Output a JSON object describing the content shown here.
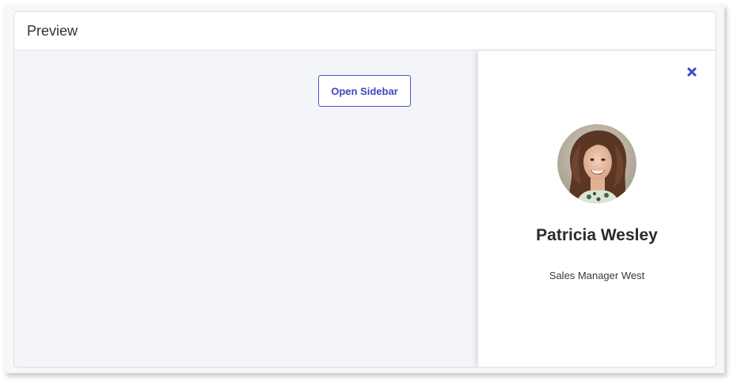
{
  "panel": {
    "title": "Preview"
  },
  "main": {
    "open_sidebar_label": "Open Sidebar"
  },
  "sidebar": {
    "close_icon": "close-icon",
    "avatar_icon": "avatar",
    "name": "Patricia Wesley",
    "role": "Sales Manager West"
  },
  "colors": {
    "accent": "#4a54c4",
    "preview_background": "#f4f5f9",
    "sidebar_background": "#ffffff"
  }
}
